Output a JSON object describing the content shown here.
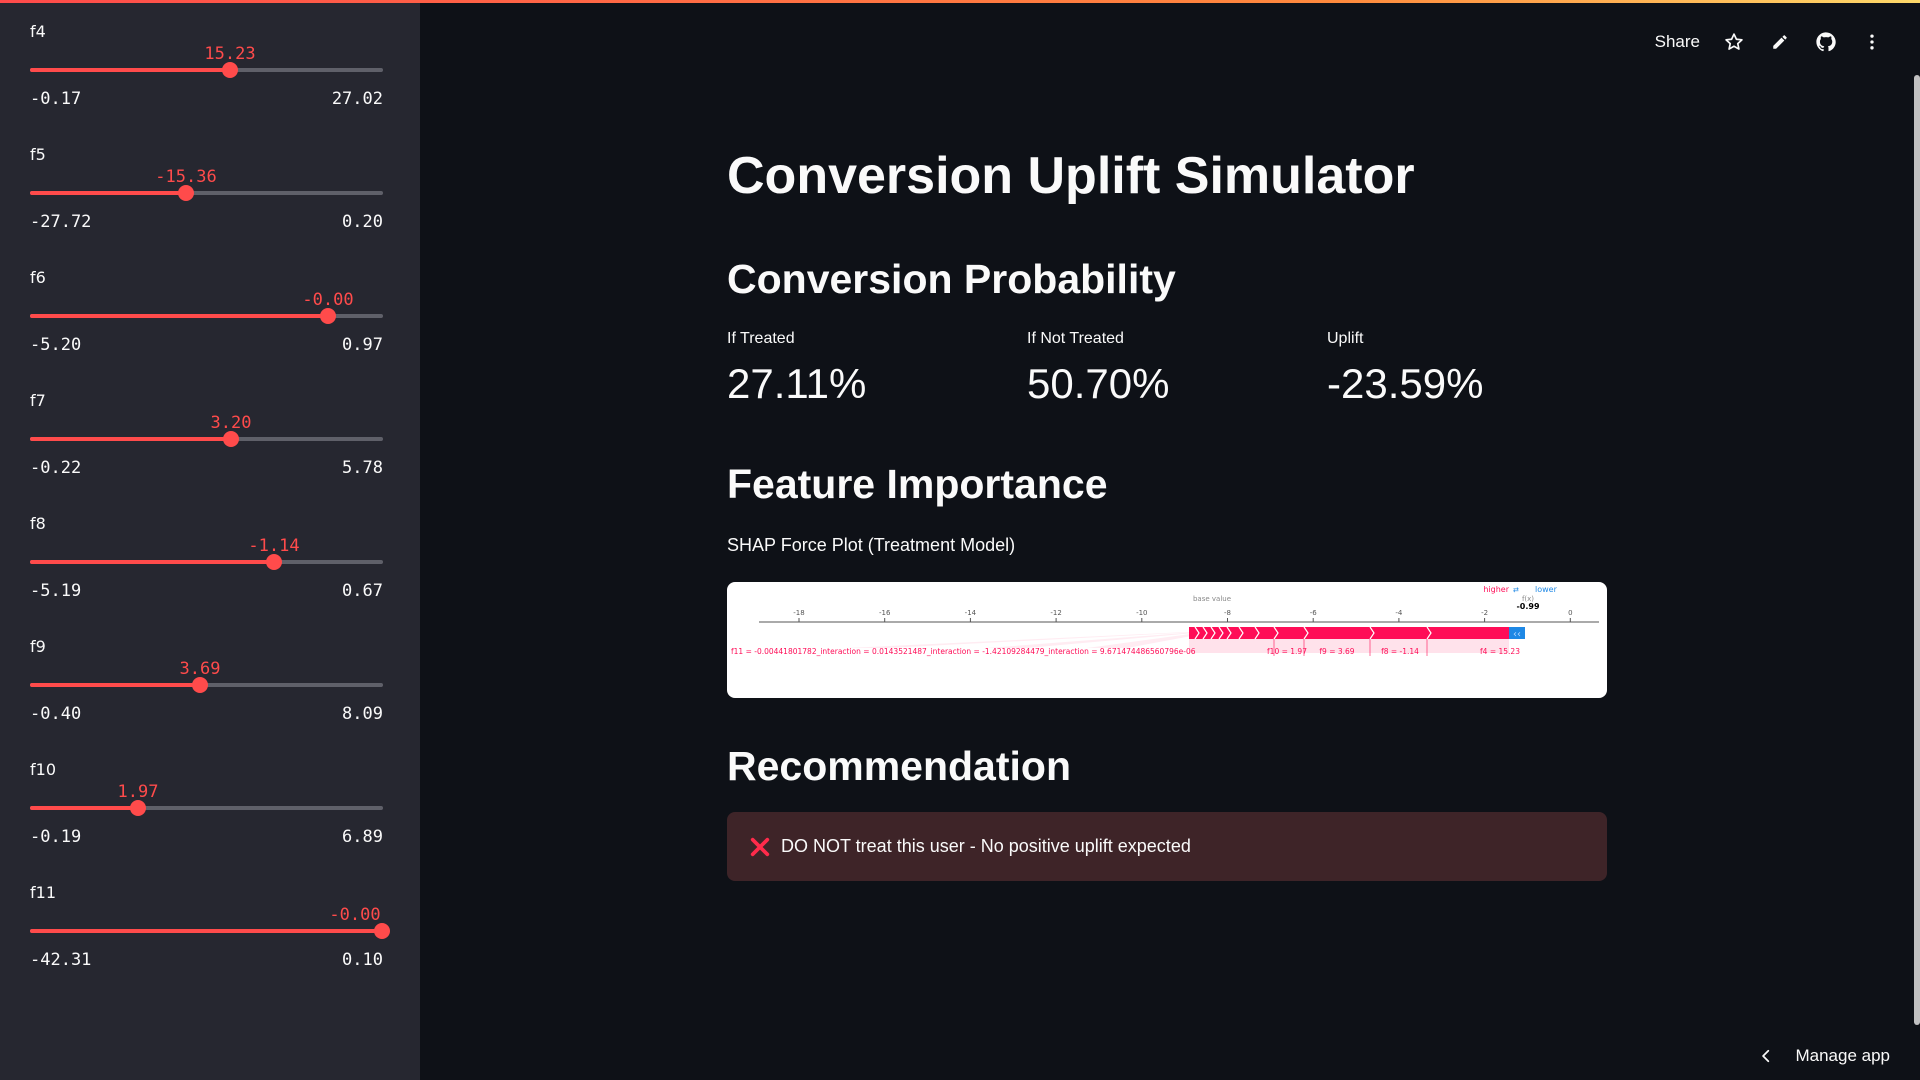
{
  "app": {
    "title": "Conversion Uplift Simulator",
    "accent_color": "#ff4b4b",
    "background_color": "#0e1117",
    "sidebar_color": "#262730"
  },
  "header": {
    "share_label": "Share",
    "icons": [
      "star-icon",
      "edit-pencil-icon",
      "github-icon",
      "more-vertical-icon"
    ]
  },
  "sidebar": {
    "sliders": [
      {
        "label": "f4",
        "value": "15.23",
        "min": "-0.17",
        "max": "27.02",
        "fraction": 0.567
      },
      {
        "label": "f5",
        "value": "-15.36",
        "min": "-27.72",
        "max": "0.20",
        "fraction": 0.443
      },
      {
        "label": "f6",
        "value": "-0.00",
        "min": "-5.20",
        "max": "0.97",
        "fraction": 0.843
      },
      {
        "label": "f7",
        "value": "3.20",
        "min": "-0.22",
        "max": "5.78",
        "fraction": 0.57
      },
      {
        "label": "f8",
        "value": "-1.14",
        "min": "-5.19",
        "max": "0.67",
        "fraction": 0.691
      },
      {
        "label": "f9",
        "value": "3.69",
        "min": "-0.40",
        "max": "8.09",
        "fraction": 0.482
      },
      {
        "label": "f10",
        "value": "1.97",
        "min": "-0.19",
        "max": "6.89",
        "fraction": 0.305
      },
      {
        "label": "f11",
        "value": "-0.00",
        "min": "-42.31",
        "max": "0.10",
        "fraction": 0.998
      }
    ]
  },
  "main": {
    "probability_heading": "Conversion Probability",
    "metrics": [
      {
        "label": "If Treated",
        "value": "27.11%"
      },
      {
        "label": "If Not Treated",
        "value": "50.70%"
      },
      {
        "label": "Uplift",
        "value": "-23.59%"
      }
    ],
    "importance_heading": "Feature Importance",
    "shap_caption": "SHAP Force Plot (Treatment Model)",
    "recommendation_heading": "Recommendation",
    "recommendation_text": "DO NOT treat this user - No positive uplift expected",
    "recommendation_icon": "cross-mark-icon"
  },
  "shap_plot": {
    "base_label": "base value",
    "higher_label": "higher",
    "lower_label": "lower",
    "fx_label": "f(x)",
    "fx_value": "-0.99",
    "ticks": [
      "-18",
      "-16",
      "-14",
      "-12",
      "-10",
      "-8",
      "-6",
      "-4",
      "-2",
      "0"
    ],
    "feature_labels": [
      "f11 = -0.00441801782_interaction = 0.0143521487_interaction = -1.42109284479_interaction = 9.671474486560796e-06",
      "f10 = 1.97",
      "f9 = 3.69",
      "f8 = -1.14",
      "f4 = 15.23"
    ],
    "colors": {
      "positive": "#ff0d57",
      "negative": "#1e88e5"
    }
  },
  "footer": {
    "manage_label": "Manage app"
  }
}
